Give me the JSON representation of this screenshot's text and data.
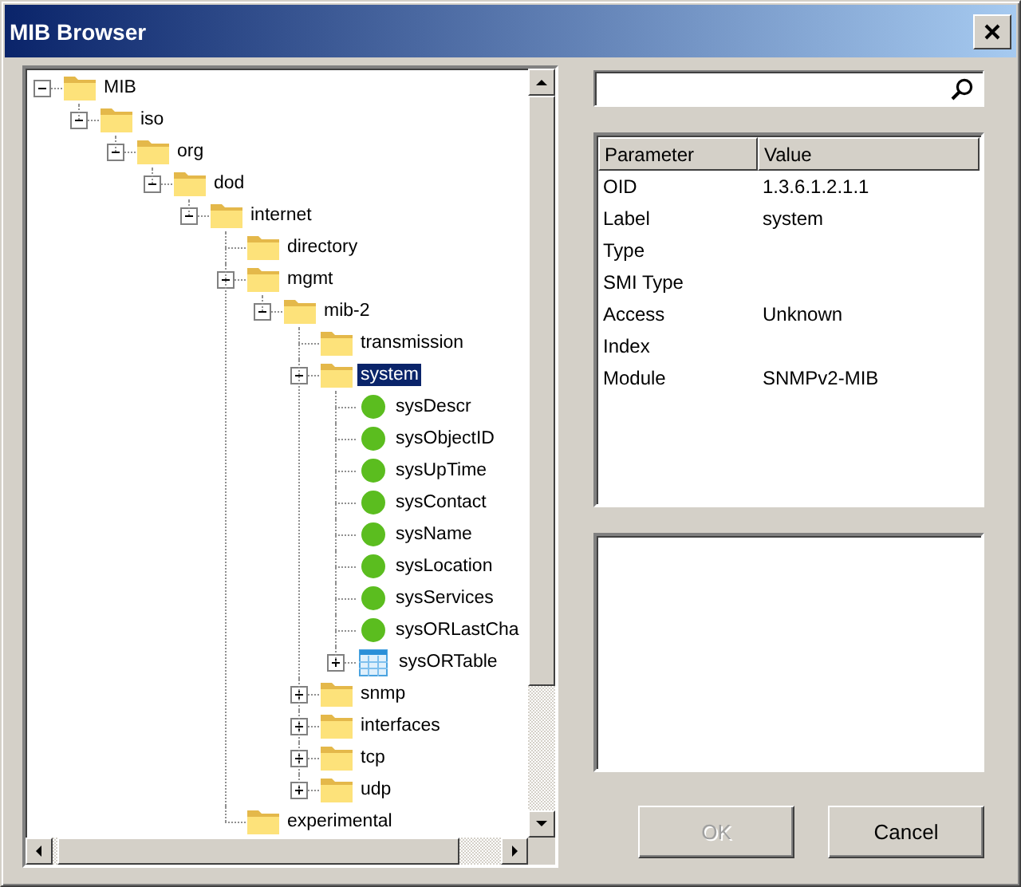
{
  "window": {
    "title": "MIB Browser"
  },
  "tree": [
    {
      "label": "MIB",
      "kind": "folder",
      "expanded": true,
      "selected": false,
      "children": [
        {
          "label": "iso",
          "kind": "folder",
          "expanded": true,
          "selected": false,
          "children": [
            {
              "label": "org",
              "kind": "folder",
              "expanded": true,
              "selected": false,
              "children": [
                {
                  "label": "dod",
                  "kind": "folder",
                  "expanded": true,
                  "selected": false,
                  "children": [
                    {
                      "label": "internet",
                      "kind": "folder",
                      "expanded": true,
                      "selected": false,
                      "children": [
                        {
                          "label": "directory",
                          "kind": "folder",
                          "selected": false
                        },
                        {
                          "label": "mgmt",
                          "kind": "folder",
                          "expanded": true,
                          "selected": false,
                          "children": [
                            {
                              "label": "mib-2",
                              "kind": "folder",
                              "expanded": true,
                              "selected": false,
                              "children": [
                                {
                                  "label": "transmission",
                                  "kind": "folder",
                                  "selected": false
                                },
                                {
                                  "label": "system",
                                  "kind": "folder",
                                  "expanded": true,
                                  "selected": true,
                                  "children": [
                                    {
                                      "label": "sysDescr",
                                      "kind": "leaf",
                                      "selected": false
                                    },
                                    {
                                      "label": "sysObjectID",
                                      "kind": "leaf",
                                      "selected": false
                                    },
                                    {
                                      "label": "sysUpTime",
                                      "kind": "leaf",
                                      "selected": false
                                    },
                                    {
                                      "label": "sysContact",
                                      "kind": "leaf",
                                      "selected": false
                                    },
                                    {
                                      "label": "sysName",
                                      "kind": "leaf",
                                      "selected": false
                                    },
                                    {
                                      "label": "sysLocation",
                                      "kind": "leaf",
                                      "selected": false
                                    },
                                    {
                                      "label": "sysServices",
                                      "kind": "leaf",
                                      "selected": false
                                    },
                                    {
                                      "label": "sysORLastCha",
                                      "kind": "leaf",
                                      "selected": false
                                    },
                                    {
                                      "label": "sysORTable",
                                      "kind": "table",
                                      "expanded": false,
                                      "selected": false
                                    }
                                  ]
                                },
                                {
                                  "label": "snmp",
                                  "kind": "folder",
                                  "expanded": false,
                                  "selected": false
                                },
                                {
                                  "label": "interfaces",
                                  "kind": "folder",
                                  "expanded": false,
                                  "selected": false
                                },
                                {
                                  "label": "tcp",
                                  "kind": "folder",
                                  "expanded": false,
                                  "selected": false
                                },
                                {
                                  "label": "udp",
                                  "kind": "folder",
                                  "expanded": false,
                                  "selected": false
                                }
                              ]
                            }
                          ]
                        },
                        {
                          "label": "experimental",
                          "kind": "folder",
                          "selected": false
                        }
                      ]
                    }
                  ]
                }
              ]
            }
          ]
        }
      ]
    }
  ],
  "table": {
    "columns": [
      "Parameter",
      "Value"
    ],
    "rows": [
      {
        "parameter": "OID",
        "value": "1.3.6.1.2.1.1"
      },
      {
        "parameter": "Label",
        "value": "system"
      },
      {
        "parameter": "Type"
      },
      {
        "parameter": "SMI Type"
      },
      {
        "parameter": "Access",
        "value": "Unknown"
      },
      {
        "parameter": "Index"
      },
      {
        "parameter": "Module",
        "value": "SNMPv2-MIB"
      }
    ]
  },
  "buttons": [
    {
      "label": "OK",
      "disabled": true
    },
    {
      "label": "Cancel",
      "disabled": false
    }
  ]
}
